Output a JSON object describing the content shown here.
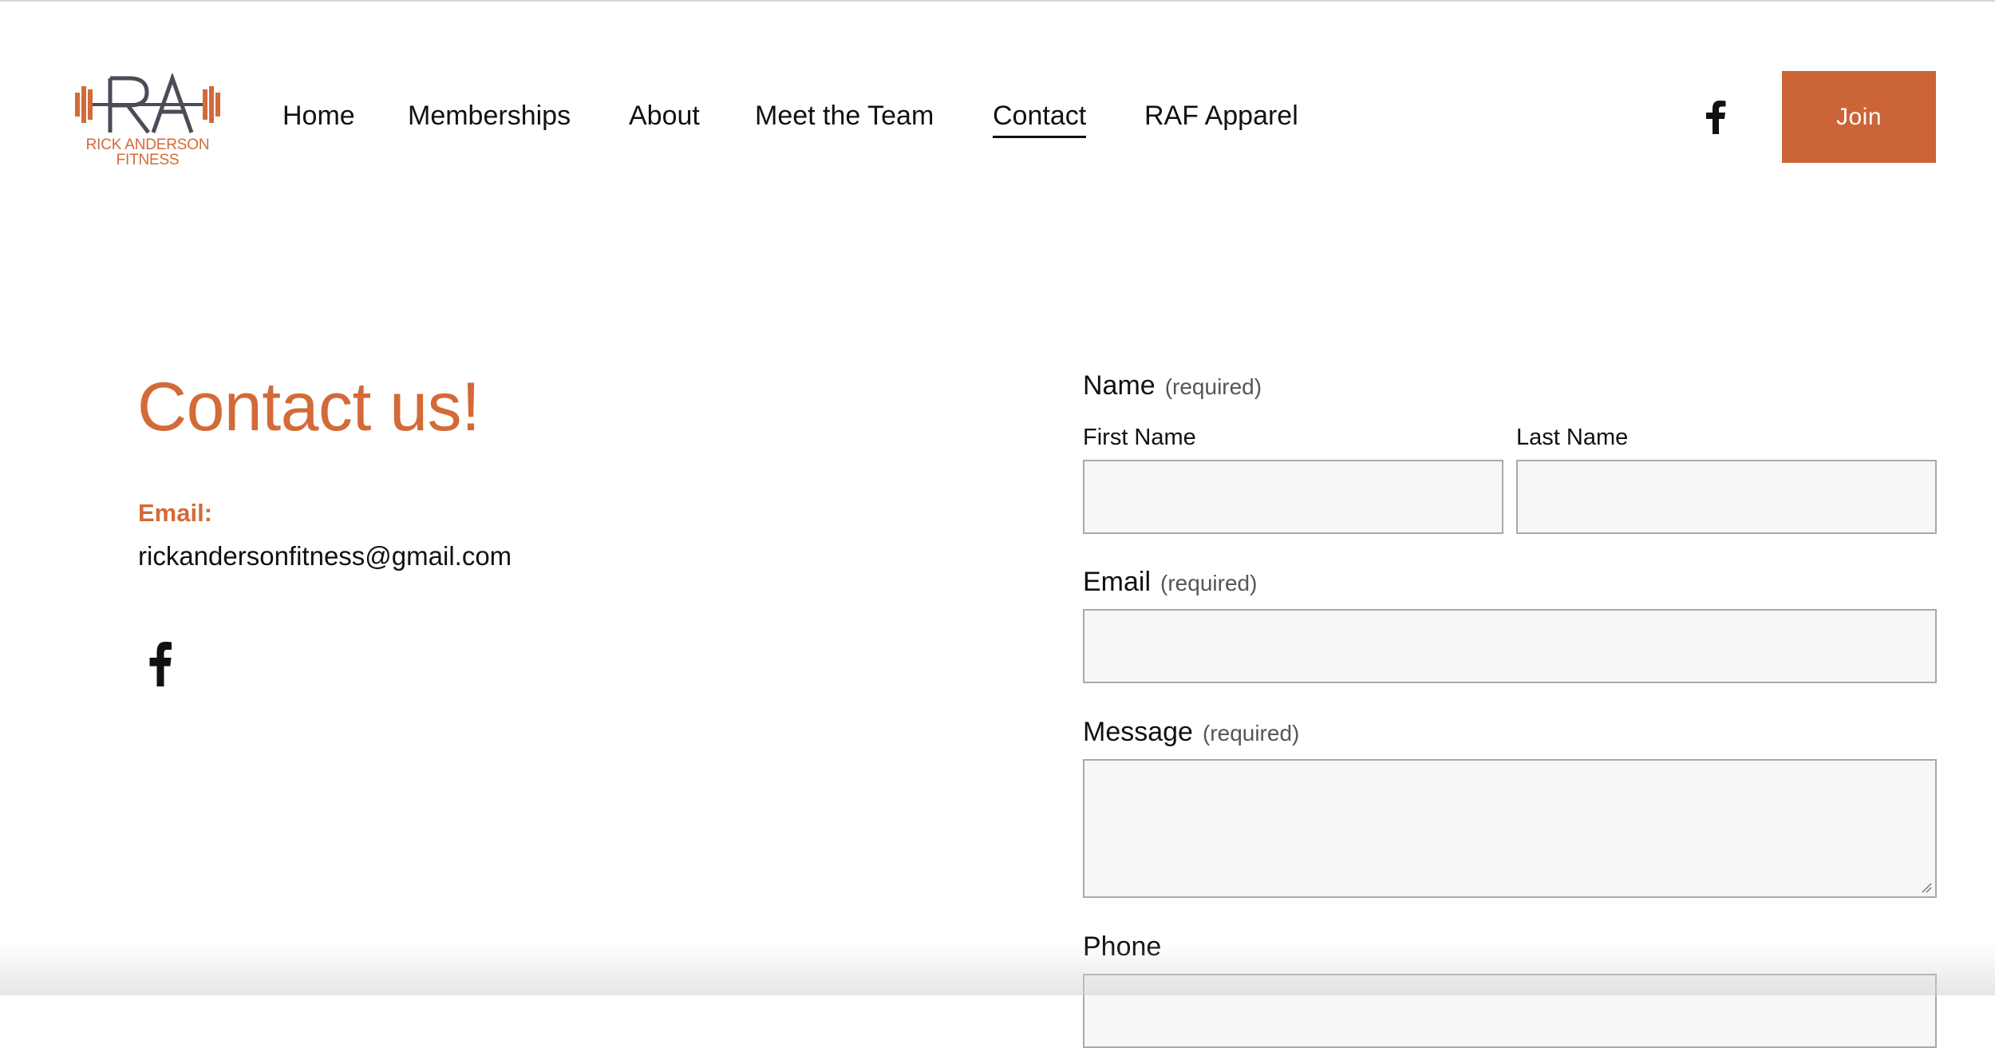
{
  "brand": {
    "logo_letters": "RA",
    "name_line1": "RICK ANDERSON",
    "name_line2": "FITNESS",
    "accent_color": "#cb6436",
    "logo_gray": "#4a4d57"
  },
  "nav": {
    "items": [
      {
        "label": "Home"
      },
      {
        "label": "Memberships"
      },
      {
        "label": "About"
      },
      {
        "label": "Meet the Team"
      },
      {
        "label": "Contact",
        "active": true
      },
      {
        "label": "RAF Apparel"
      }
    ],
    "social_icon": "facebook-icon",
    "join_label": "Join"
  },
  "contact": {
    "title": "Contact us!",
    "email_label": "Email:",
    "email_value": "rickandersonfitness@gmail.com",
    "social_icon": "facebook-icon"
  },
  "form": {
    "name_label": "Name",
    "name_required": "(required)",
    "first_name_label": "First Name",
    "first_name_value": "",
    "last_name_label": "Last Name",
    "last_name_value": "",
    "email_label": "Email",
    "email_required": "(required)",
    "email_value": "",
    "message_label": "Message",
    "message_required": "(required)",
    "message_value": "",
    "phone_label": "Phone",
    "phone_value": ""
  }
}
